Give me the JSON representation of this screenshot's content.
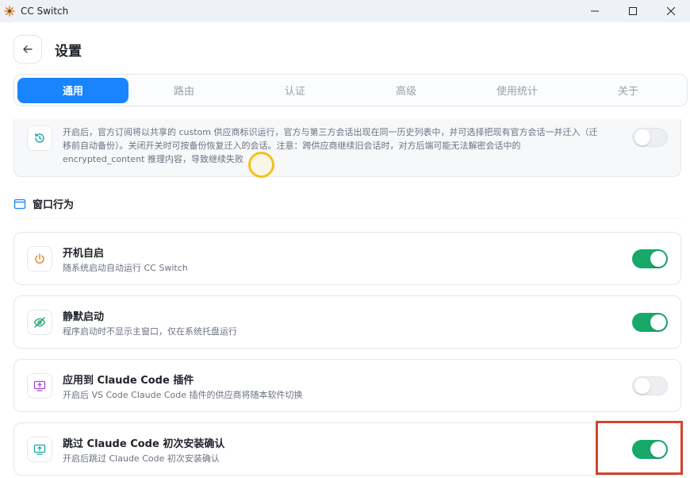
{
  "window": {
    "title": "CC Switch"
  },
  "header": {
    "title": "设置"
  },
  "tabs": [
    {
      "label": "通用",
      "active": true
    },
    {
      "label": "路由",
      "active": false
    },
    {
      "label": "认证",
      "active": false
    },
    {
      "label": "高级",
      "active": false
    },
    {
      "label": "使用统计",
      "active": false
    },
    {
      "label": "关于",
      "active": false
    }
  ],
  "top_card": {
    "description": "开启后，官方订阅将以共享的 custom 供应商标识运行，官方与第三方会话出现在同一历史列表中，并可选择把现有官方会话一并迁入（迁移前自动备份）。关闭开关时可按备份恢复迁入的会话。注意：跨供应商继续旧会话时，对方后端可能无法解密会话中的 encrypted_content 推理内容，导致继续失败",
    "enabled": false,
    "icon": "history-icon"
  },
  "section": {
    "title": "窗口行为",
    "icon": "window-icon"
  },
  "settings": [
    {
      "title": "开机自启",
      "description": "随系统启动自动运行 CC Switch",
      "enabled": true,
      "icon": "power-icon",
      "icon_color": "#e8812a"
    },
    {
      "title": "静默启动",
      "description": "程序启动时不显示主窗口，仅在系统托盘运行",
      "enabled": true,
      "icon": "eye-off-icon",
      "icon_color": "#17a86a"
    },
    {
      "title": "应用到 Claude Code 插件",
      "description": "开启后 VS Code Claude Code 插件的供应商将随本软件切换",
      "enabled": false,
      "icon": "monitor-icon",
      "icon_color": "#a347c9"
    },
    {
      "title": "跳过 Claude Code 初次安装确认",
      "description": "开启后跳过 Claude Code 初次安装确认",
      "enabled": true,
      "icon": "monitor-check-icon",
      "icon_color": "#1aa3a3"
    }
  ],
  "colors": {
    "accent": "#1a84ff",
    "toggle_on": "#17a86a",
    "highlight": "#d0462c"
  }
}
